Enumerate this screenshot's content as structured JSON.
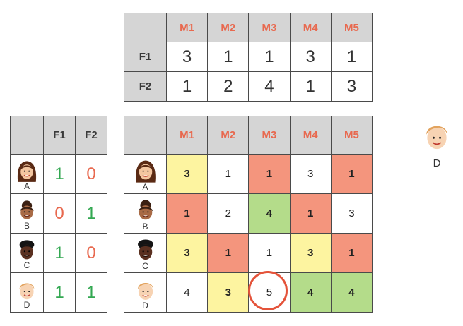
{
  "feature_table": {
    "columns": [
      "M1",
      "M2",
      "M3",
      "M4",
      "M5"
    ],
    "rows": [
      {
        "label": "F1",
        "values": [
          "3",
          "1",
          "1",
          "3",
          "1"
        ]
      },
      {
        "label": "F2",
        "values": [
          "1",
          "2",
          "4",
          "1",
          "3"
        ]
      }
    ]
  },
  "user_table": {
    "columns": [
      "F1",
      "F2"
    ],
    "rows": [
      {
        "user": "A",
        "values": [
          "1",
          "0"
        ]
      },
      {
        "user": "B",
        "values": [
          "0",
          "1"
        ]
      },
      {
        "user": "C",
        "values": [
          "1",
          "0"
        ]
      },
      {
        "user": "D",
        "values": [
          "1",
          "1"
        ]
      }
    ]
  },
  "rating_table": {
    "columns": [
      "M1",
      "M2",
      "M3",
      "M4",
      "M5"
    ],
    "rows": [
      {
        "user": "A",
        "values": [
          "3",
          "1",
          "1",
          "3",
          "1"
        ]
      },
      {
        "user": "B",
        "values": [
          "1",
          "2",
          "4",
          "1",
          "3"
        ]
      },
      {
        "user": "C",
        "values": [
          "3",
          "1",
          "1",
          "3",
          "1"
        ]
      },
      {
        "user": "D",
        "values": [
          "4",
          "3",
          "5",
          "4",
          "4"
        ]
      }
    ]
  },
  "new_user": {
    "label": "D"
  },
  "colors": {
    "header": "#d5d5d5",
    "movie_header": "#e8694f",
    "yellow": "#fdf4a0",
    "red": "#f4957d",
    "green": "#b4dc8a",
    "circle": "#e4533a"
  }
}
